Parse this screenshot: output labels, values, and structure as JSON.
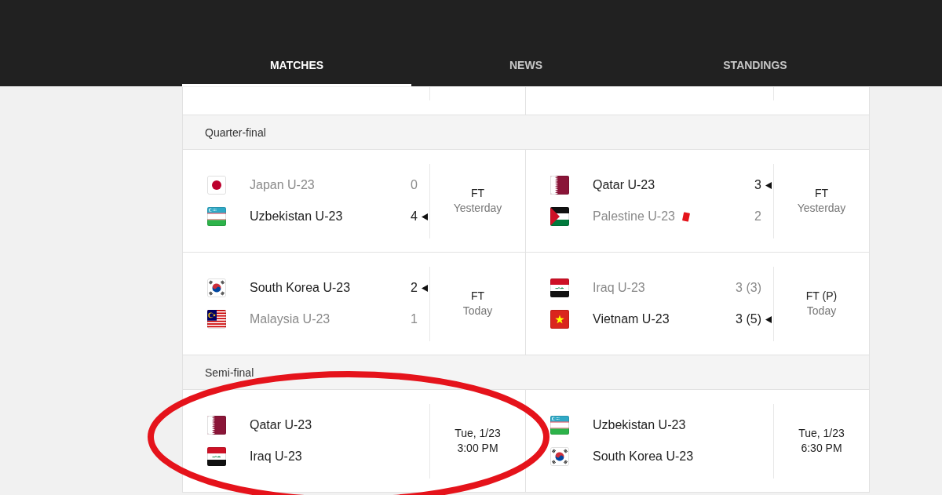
{
  "tabs": [
    {
      "label": "MATCHES",
      "selected": true
    },
    {
      "label": "NEWS",
      "selected": false
    },
    {
      "label": "STANDINGS",
      "selected": false
    }
  ],
  "sections": [
    {
      "title": "Quarter-final",
      "rows": [
        {
          "matches": [
            {
              "kind": "finished",
              "circled": false,
              "teams": [
                {
                  "name": "Japan U-23",
                  "kind": "japan",
                  "score": "0",
                  "winner": false,
                  "red_card": false
                },
                {
                  "name": "Uzbekistan U-23",
                  "kind": "uzbekistan",
                  "score": "4",
                  "winner": true,
                  "red_card": false
                }
              ],
              "status": "FT",
              "when": "Yesterday"
            },
            {
              "kind": "finished",
              "circled": false,
              "teams": [
                {
                  "name": "Qatar U-23",
                  "kind": "qatar",
                  "score": "3",
                  "winner": true,
                  "red_card": false
                },
                {
                  "name": "Palestine U-23",
                  "kind": "palestine",
                  "score": "2",
                  "winner": false,
                  "red_card": true
                }
              ],
              "status": "FT",
              "when": "Yesterday"
            }
          ]
        },
        {
          "matches": [
            {
              "kind": "finished",
              "circled": false,
              "teams": [
                {
                  "name": "South Korea U-23",
                  "kind": "korea",
                  "score": "2",
                  "winner": true,
                  "red_card": false
                },
                {
                  "name": "Malaysia U-23",
                  "kind": "malaysia",
                  "score": "1",
                  "winner": false,
                  "red_card": false
                }
              ],
              "status": "FT",
              "when": "Today"
            },
            {
              "kind": "finished",
              "circled": false,
              "teams": [
                {
                  "name": "Iraq U-23",
                  "kind": "iraq",
                  "score": "3 (3)",
                  "winner": false,
                  "red_card": false
                },
                {
                  "name": "Vietnam U-23",
                  "kind": "vietnam",
                  "score": "3 (5)",
                  "winner": true,
                  "red_card": false
                }
              ],
              "status": "FT (P)",
              "when": "Today"
            }
          ]
        }
      ]
    },
    {
      "title": "Semi-final",
      "rows": [
        {
          "matches": [
            {
              "kind": "scheduled",
              "circled": true,
              "teams": [
                {
                  "name": "Qatar U-23",
                  "kind": "qatar",
                  "winner": false,
                  "red_card": false
                },
                {
                  "name": "Iraq U-23",
                  "kind": "iraq",
                  "winner": false,
                  "red_card": false
                }
              ],
              "date": "Tue, 1/23",
              "time": "3:00 PM"
            },
            {
              "kind": "scheduled",
              "circled": false,
              "teams": [
                {
                  "name": "Uzbekistan U-23",
                  "kind": "uzbekistan",
                  "winner": false,
                  "red_card": false
                },
                {
                  "name": "South Korea U-23",
                  "kind": "korea",
                  "winner": false,
                  "red_card": false
                }
              ],
              "date": "Tue, 1/23",
              "time": "6:30 PM"
            }
          ]
        }
      ]
    }
  ]
}
